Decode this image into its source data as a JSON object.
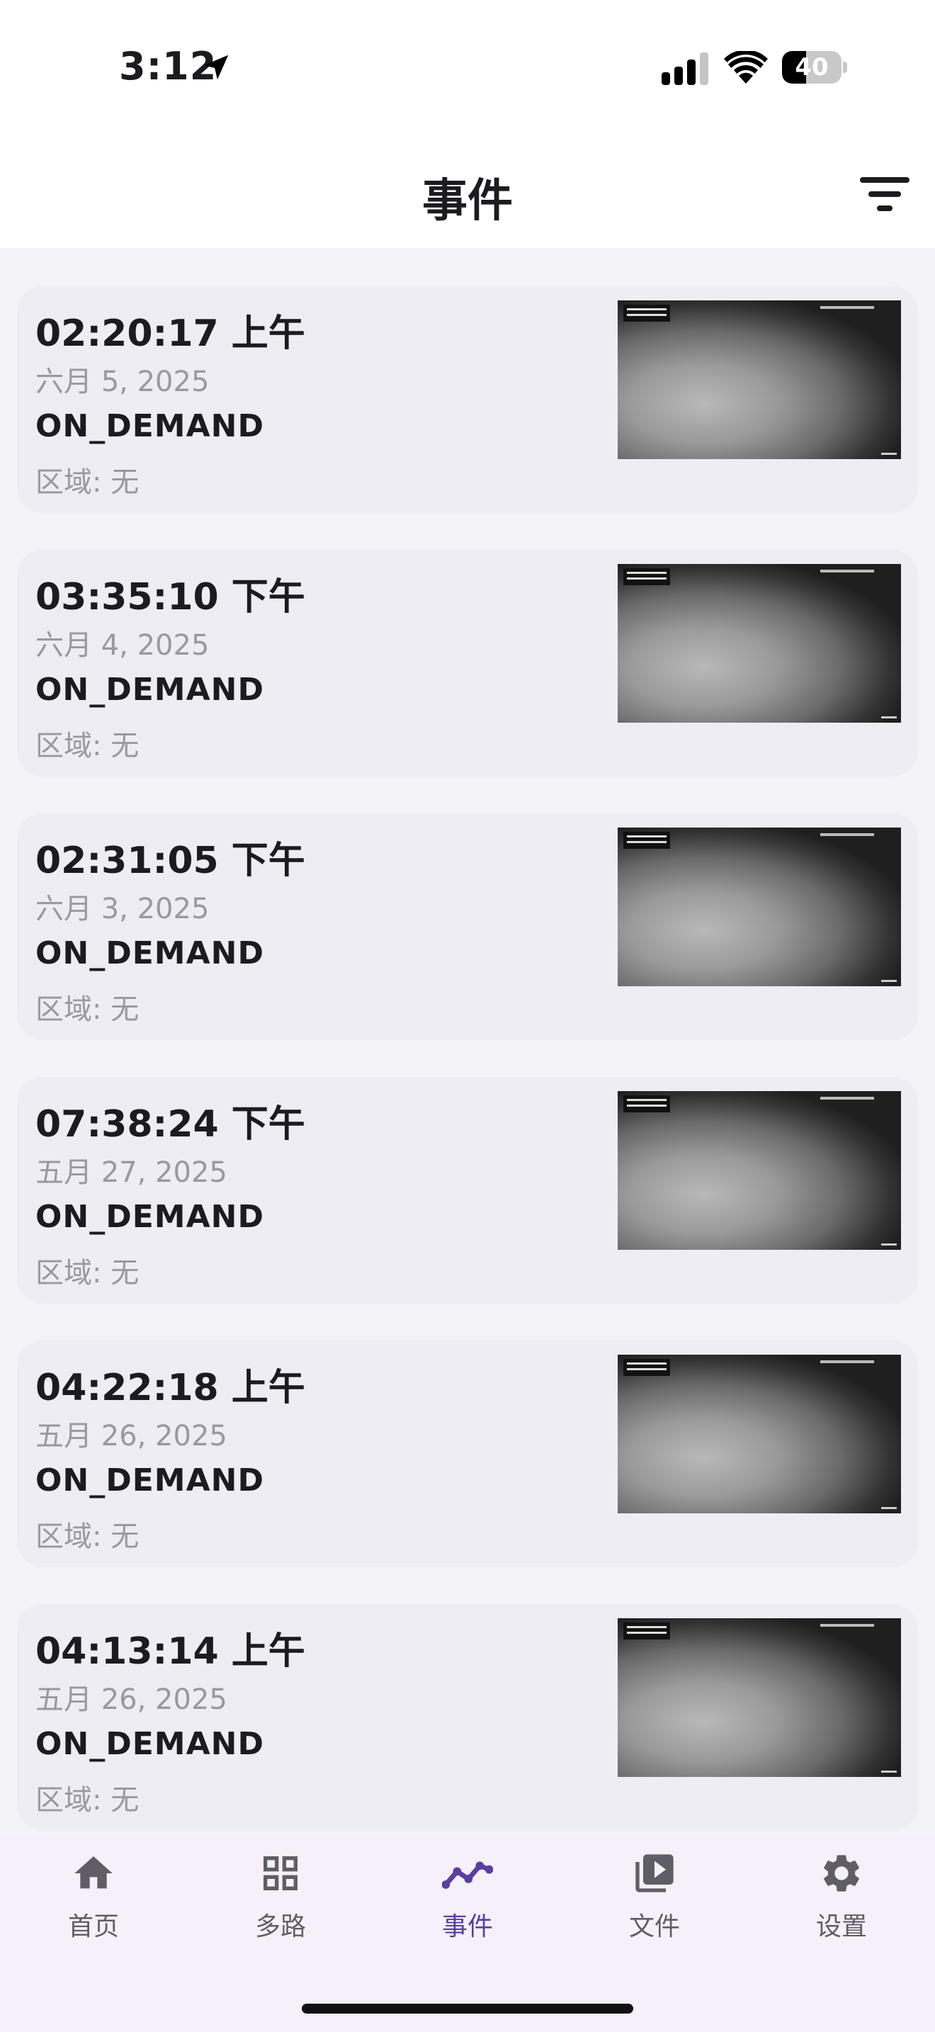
{
  "status_bar": {
    "time": "3:12",
    "battery": "40",
    "battery_level": 0.4
  },
  "header": {
    "title": "事件",
    "filter_icon": "filter-icon"
  },
  "events": [
    {
      "time": "02:20:17 上午",
      "date": "六月 5, 2025",
      "type": "ON_DEMAND",
      "zone": "区域: 无"
    },
    {
      "time": "03:35:10 下午",
      "date": "六月 4, 2025",
      "type": "ON_DEMAND",
      "zone": "区域: 无"
    },
    {
      "time": "02:31:05 下午",
      "date": "六月 3, 2025",
      "type": "ON_DEMAND",
      "zone": "区域: 无"
    },
    {
      "time": "07:38:24 下午",
      "date": "五月 27, 2025",
      "type": "ON_DEMAND",
      "zone": "区域: 无"
    },
    {
      "time": "04:22:18 上午",
      "date": "五月 26, 2025",
      "type": "ON_DEMAND",
      "zone": "区域: 无"
    },
    {
      "time": "04:13:14 上午",
      "date": "五月 26, 2025",
      "type": "ON_DEMAND",
      "zone": "区域: 无"
    }
  ],
  "tabs": [
    {
      "label": "首页",
      "icon": "home-icon"
    },
    {
      "label": "多路",
      "icon": "grid-icon"
    },
    {
      "label": "事件",
      "icon": "events-chart-icon",
      "active": true
    },
    {
      "label": "文件",
      "icon": "video-library-icon"
    },
    {
      "label": "设置",
      "icon": "gear-icon"
    }
  ],
  "colors": {
    "accent": "#5b3fa0",
    "card_bg": "#efedf4",
    "page_bg": "#f4f3f8",
    "tabbar_bg": "#f6f0fa"
  }
}
